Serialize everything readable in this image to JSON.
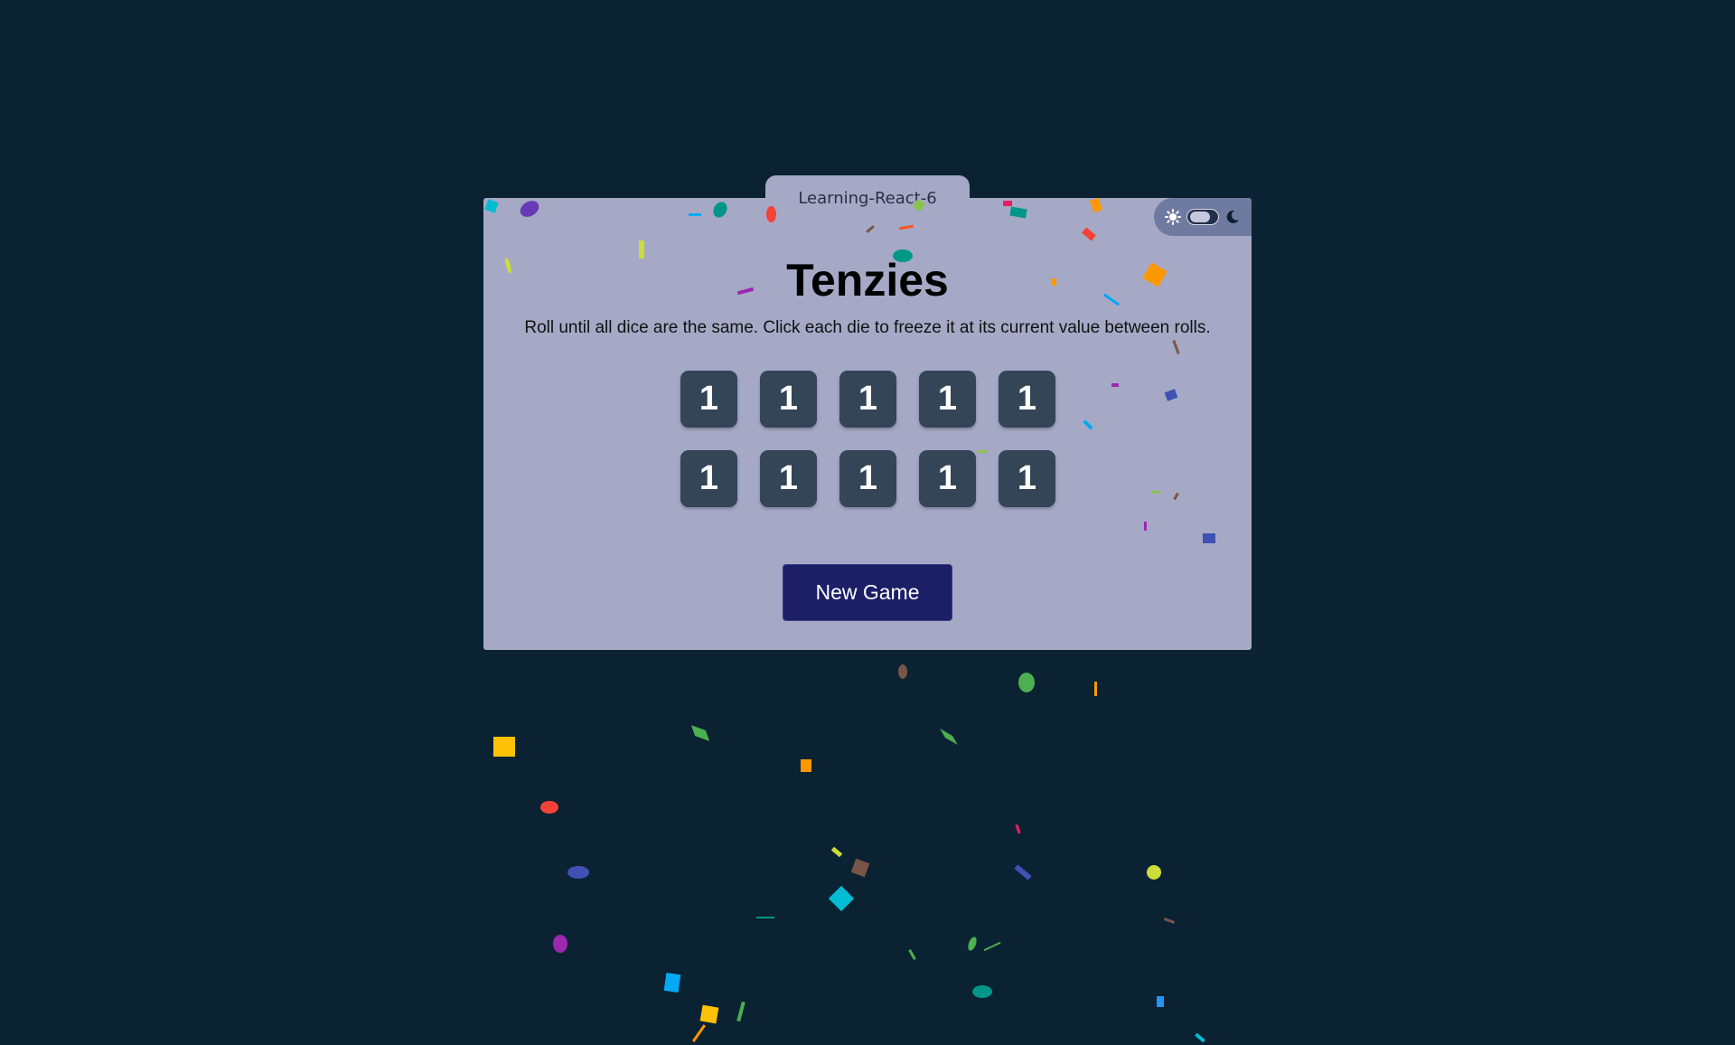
{
  "tab": {
    "label": "Learning-React-6"
  },
  "theme_toggle": {
    "light_icon": "sun-icon",
    "dark_icon": "moon-icon",
    "mode": "light"
  },
  "game": {
    "title": "Tenzies",
    "instructions": "Roll until all dice are the same. Click each die to freeze it at its current value between rolls.",
    "dice": [
      "1",
      "1",
      "1",
      "1",
      "1",
      "1",
      "1",
      "1",
      "1",
      "1"
    ],
    "button_label": "New Game"
  },
  "colors": {
    "background": "#0b2233",
    "card": "#a5a9c6",
    "die": "#334557",
    "button": "#1c1f66"
  }
}
